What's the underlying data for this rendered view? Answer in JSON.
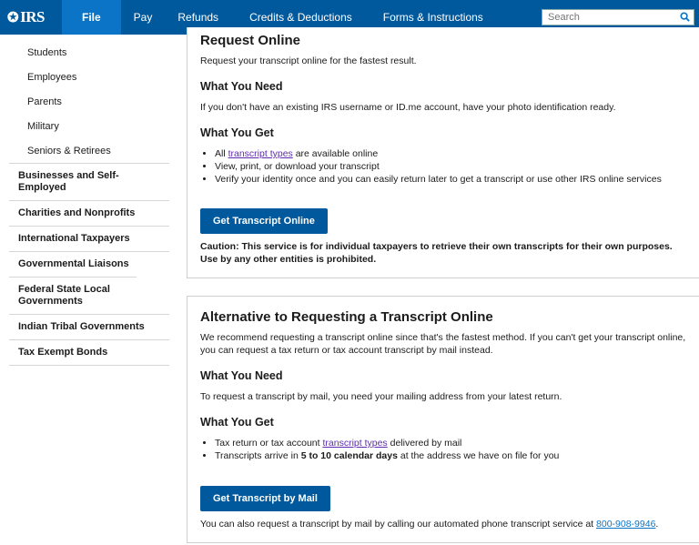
{
  "header": {
    "logo_text": "IRS",
    "nav": [
      "File",
      "Pay",
      "Refunds",
      "Credits & Deductions",
      "Forms & Instructions"
    ],
    "search_placeholder": "Search"
  },
  "sidebar": {
    "sub_items": [
      "Students",
      "Employees",
      "Parents",
      "Military",
      "Seniors & Retirees"
    ],
    "items": [
      "Businesses and Self-Employed",
      "Charities and Nonprofits",
      "International Taxpayers",
      "Governmental Liaisons",
      "Federal State Local Governments",
      "Indian Tribal Governments",
      "Tax Exempt Bonds"
    ]
  },
  "online": {
    "title": "Request Online",
    "intro": "Request your transcript online for the fastest result.",
    "need_heading": "What You Need",
    "need_text": "If you don't have an existing IRS username or ID.me account, have your photo identification ready.",
    "get_heading": "What You Get",
    "bullet1_pre": "All ",
    "bullet1_link": "transcript types",
    "bullet1_post": " are available online",
    "bullet2": "View, print, or download your transcript",
    "bullet3": "Verify your identity once and you can easily return later to get a transcript or use other IRS online services",
    "button": "Get Transcript Online",
    "caution": "Caution: This service is for individual taxpayers to retrieve their own transcripts for their own purposes. Use by any other entities is prohibited."
  },
  "mail": {
    "title": "Alternative to Requesting a Transcript Online",
    "intro": "We recommend requesting a transcript online since that's the fastest method. If you can't get your transcript online, you can request a tax return or tax account transcript by mail instead.",
    "need_heading": "What You Need",
    "need_text": "To request a transcript by mail, you need your mailing address from your latest return.",
    "get_heading": "What You Get",
    "bullet1_pre": "Tax return or tax account ",
    "bullet1_link": "transcript types",
    "bullet1_post": " delivered by mail",
    "bullet2_pre": "Transcripts arrive in ",
    "bullet2_bold": "5 to 10 calendar days",
    "bullet2_post": " at the address we have on file for you",
    "button": "Get Transcript by Mail",
    "phone_pre": "You can also request a transcript by mail by calling our automated phone transcript service at ",
    "phone_link": "800-908-9946",
    "phone_post": "."
  },
  "colors": {
    "nav_bg": "#00599c",
    "nav_active": "#0b74c6",
    "button_bg": "#00599c",
    "link_visited": "#5f2ab0"
  },
  "icons": {
    "logo": "irs-eagle-icon",
    "search": "search-icon"
  }
}
